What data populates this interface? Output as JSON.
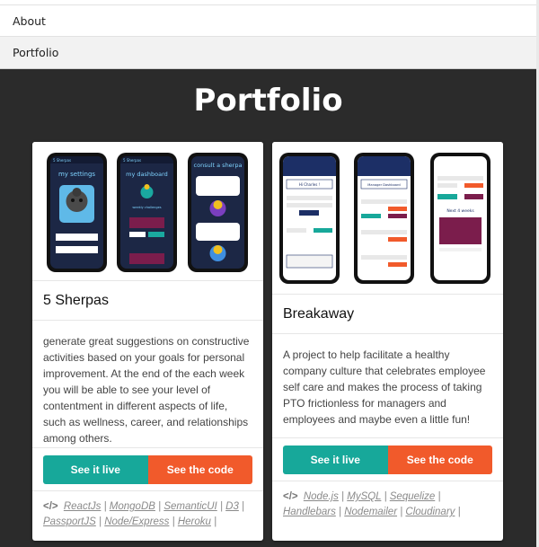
{
  "nav": {
    "items": [
      {
        "label": "About"
      },
      {
        "label": "Portfolio"
      }
    ]
  },
  "page": {
    "title": "Portfolio"
  },
  "projects": [
    {
      "title": "5 Sherpas",
      "screens": {
        "s1_header": "5 Sherpas",
        "s1_title": "my settings",
        "s2_header": "5 Sherpas",
        "s2_title": "my dashboard",
        "s2_subtitle": "weekly challenges",
        "s3_title": "consult a sherpa"
      },
      "description": "generate great suggestions on constructive activities based on your goals for personal improvement. At the end of the each week you will be able to see your level of contentment in different aspects of life, such as wellness, career, and relationships among others.",
      "live_label": "See it live",
      "code_label": "See the code",
      "tech": [
        "ReactJs",
        "MongoDB",
        "SemanticUI",
        "D3",
        "PassportJS",
        "Node/Express",
        "Heroku"
      ]
    },
    {
      "title": "Breakaway",
      "screens": {
        "s1_title": "Hi Charles !",
        "s2_title": "Manager Dashboard",
        "s3_title": "Next 4 weeks"
      },
      "description": "A project to help facilitate a healthy company culture that celebrates employee self care and makes the process of taking PTO frictionless for managers and employees and maybe even a little fun!",
      "live_label": "See it live",
      "code_label": "See the code",
      "tech": [
        "Node.js",
        "MySQL",
        "Sequelize",
        "Handlebars",
        "Nodemailer",
        "Cloudinary"
      ]
    }
  ],
  "colors": {
    "background": "#2b2b2b",
    "live_button": "#17a89a",
    "code_button": "#f15a2b",
    "sherpa_screen": "#1c2745",
    "breakaway_header": "#1c2f66",
    "calendar": "#7b1d4c"
  },
  "icons": {
    "code": "code-icon"
  }
}
